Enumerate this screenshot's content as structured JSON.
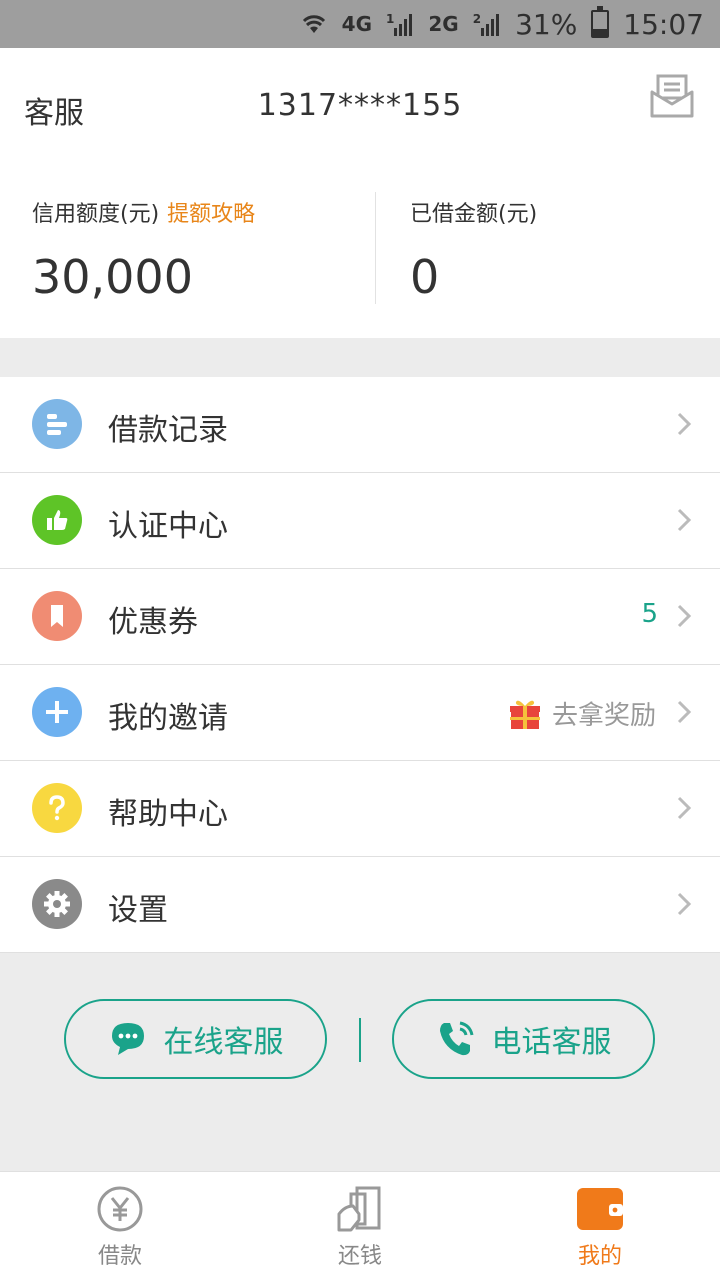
{
  "status_bar": {
    "network_1": "4G",
    "network_2": "2G",
    "sim_1": "1",
    "sim_2": "2",
    "battery_text": "31%",
    "battery_level": 0.31,
    "time": "15:07"
  },
  "header": {
    "service_label": "客服",
    "phone_masked": "1317****155",
    "credit_label": "信用额度(元)",
    "credit_link": "提额攻略",
    "credit_value": "30,000",
    "borrowed_label": "已借金额(元)",
    "borrowed_value": "0"
  },
  "menu": {
    "items": [
      {
        "label": "借款记录",
        "icon": "list-icon",
        "color": "#7eb6e6"
      },
      {
        "label": "认证中心",
        "icon": "thumbs-up-icon",
        "color": "#5ec427"
      },
      {
        "label": "优惠券",
        "icon": "bookmark-icon",
        "color": "#f08c73",
        "badge": "5"
      },
      {
        "label": "我的邀请",
        "icon": "plus-icon",
        "color": "#6eb1f0",
        "extra": "去拿奖励"
      },
      {
        "label": "帮助中心",
        "icon": "question-icon",
        "color": "#f8d840"
      },
      {
        "label": "设置",
        "icon": "gear-icon",
        "color": "#8a8a8a"
      }
    ]
  },
  "service_buttons": {
    "online": "在线客服",
    "phone": "电话客服"
  },
  "tabs": [
    {
      "label": "借款",
      "icon": "yen-circle-icon"
    },
    {
      "label": "还钱",
      "icon": "hand-card-icon"
    },
    {
      "label": "我的",
      "icon": "wallet-icon"
    }
  ],
  "colors": {
    "accent_orange": "#f07a1a",
    "teal": "#1aa38a"
  }
}
